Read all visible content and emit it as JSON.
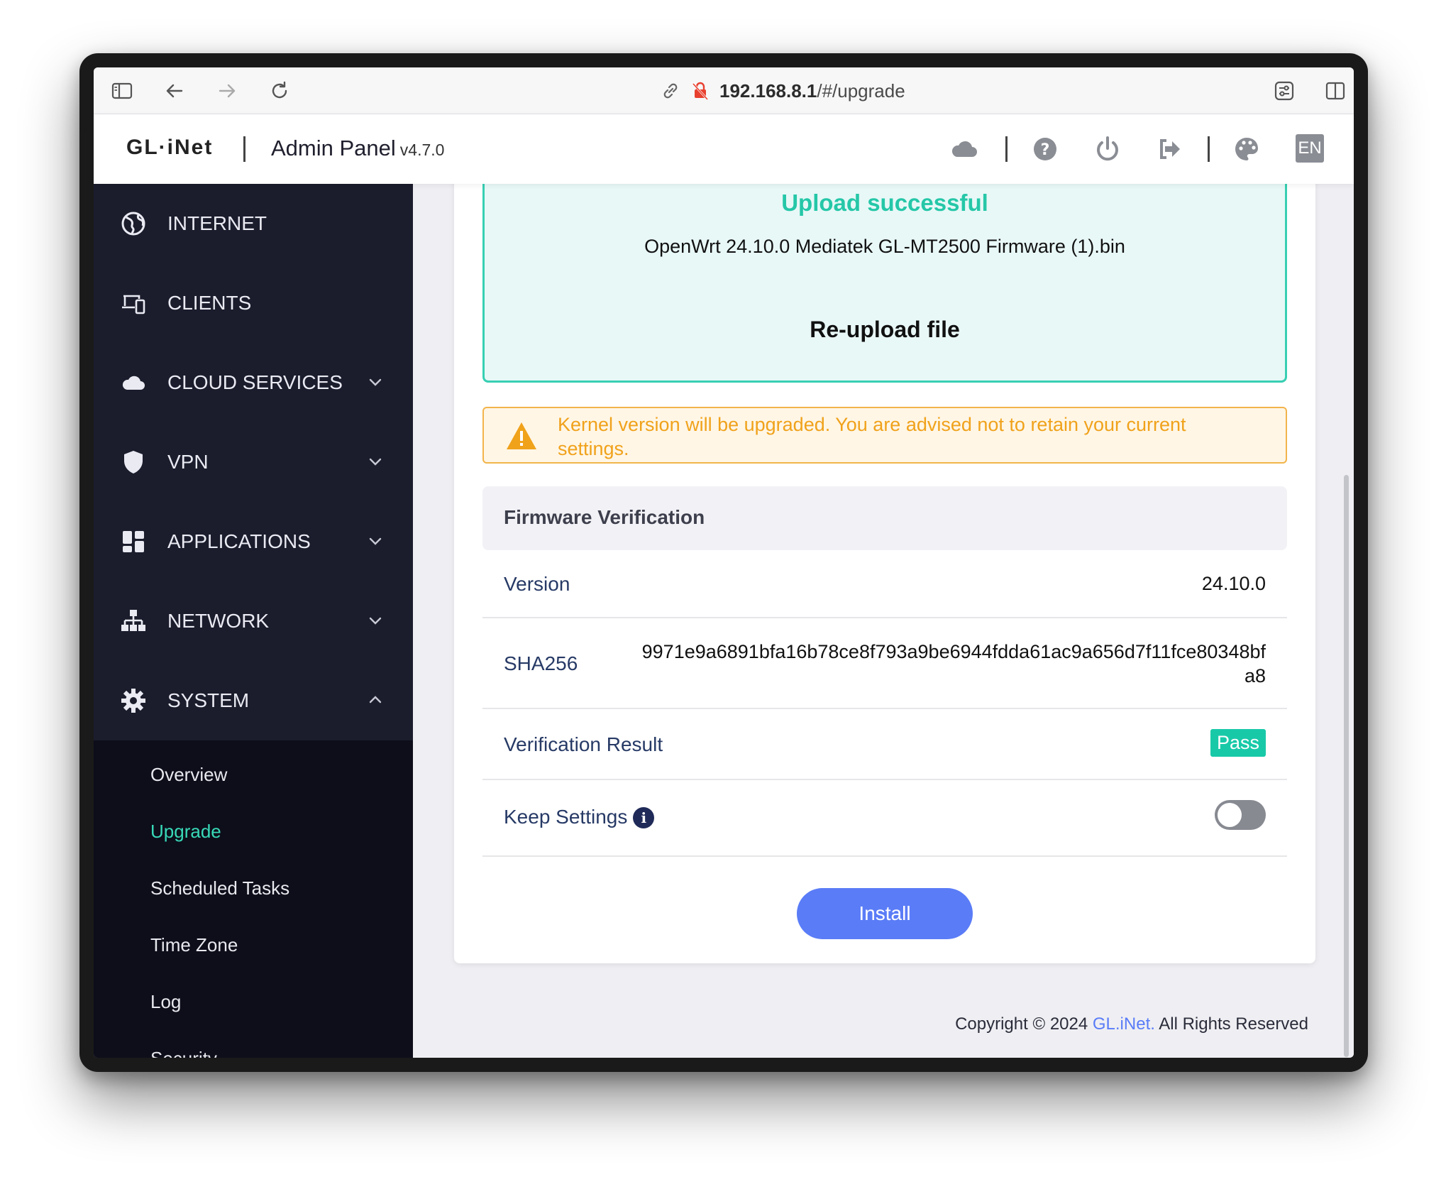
{
  "browser": {
    "url_host": "192.168.8.1",
    "url_path": "/#/upgrade"
  },
  "header": {
    "logo": "GL·iNet",
    "title": "Admin Panel",
    "version": "v4.7.0",
    "language": "EN"
  },
  "sidebar": {
    "items": [
      {
        "label": "INTERNET",
        "icon": "globe-icon"
      },
      {
        "label": "CLIENTS",
        "icon": "devices-icon"
      },
      {
        "label": "CLOUD SERVICES",
        "icon": "cloud-icon"
      },
      {
        "label": "VPN",
        "icon": "shield-icon"
      },
      {
        "label": "APPLICATIONS",
        "icon": "apps-grid-icon"
      },
      {
        "label": "NETWORK",
        "icon": "network-icon"
      },
      {
        "label": "SYSTEM",
        "icon": "gear-icon"
      }
    ],
    "system_sub": [
      "Overview",
      "Upgrade",
      "Scheduled Tasks",
      "Time Zone",
      "Log",
      "Security"
    ],
    "active_sub": "Upgrade"
  },
  "upload": {
    "status": "Upload successful",
    "filename": "OpenWrt 24.10.0 Mediatek GL-MT2500 Firmware (1).bin",
    "reupload": "Re-upload file"
  },
  "warning": "Kernel version will be upgraded. You are advised not to retain your current settings.",
  "verification": {
    "title": "Firmware Verification",
    "version_label": "Version",
    "version_value": "24.10.0",
    "sha_label": "SHA256",
    "sha_line1": "9971e9a6891bfa16b78ce8f793a9be6944fdda61ac9a656d7f11fce80348bf",
    "sha_line2": "a8",
    "result_label": "Verification Result",
    "result_value": "Pass",
    "keep_label": "Keep Settings",
    "keep_on": false
  },
  "install_label": "Install",
  "footer": {
    "prefix": "Copyright © 2024",
    "link": "GL.iNet.",
    "suffix": "All Rights Reserved"
  },
  "colors": {
    "accent": "#25c7a8",
    "primary": "#5a7cf7",
    "warning": "#f0a21b",
    "sidebar": "#1b1c2c"
  }
}
